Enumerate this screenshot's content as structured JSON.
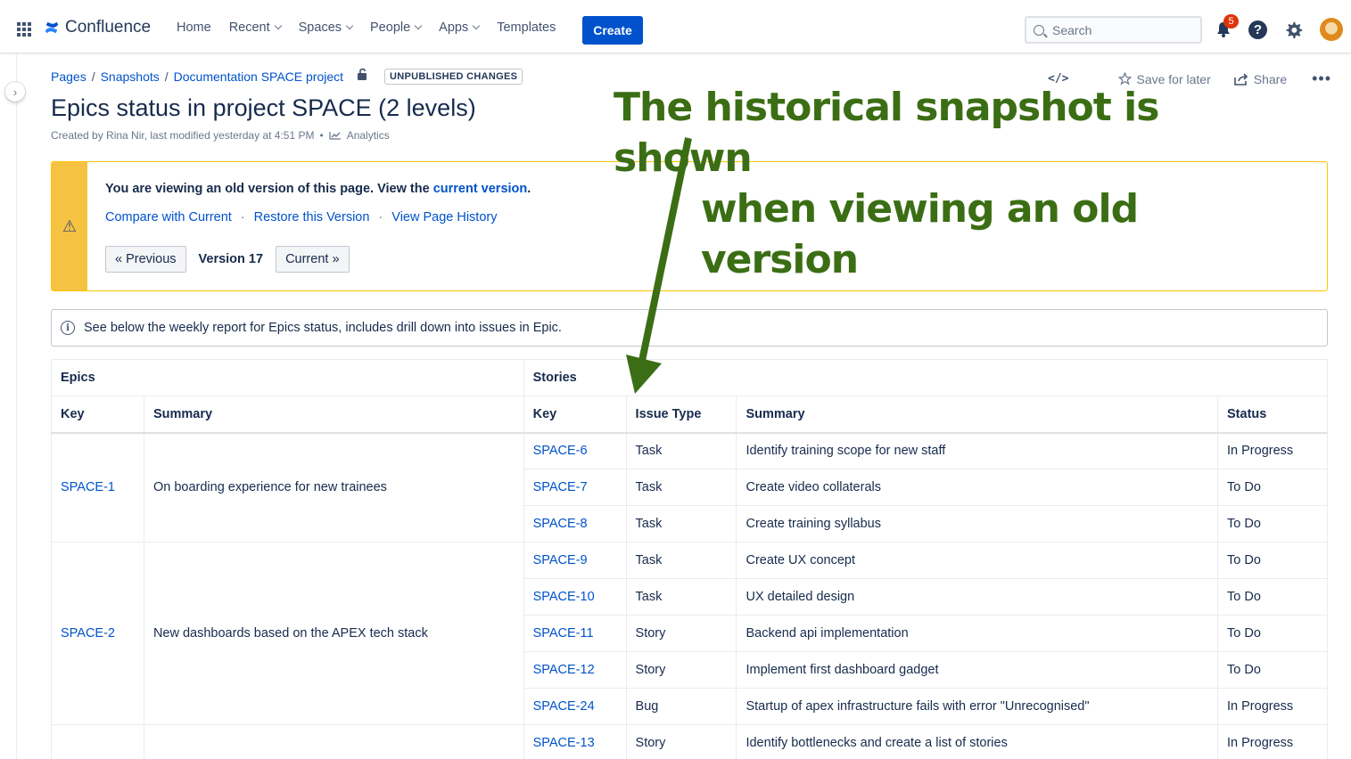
{
  "topnav": {
    "product": "Confluence",
    "items": [
      {
        "label": "Home",
        "dropdown": false
      },
      {
        "label": "Recent",
        "dropdown": true
      },
      {
        "label": "Spaces",
        "dropdown": true
      },
      {
        "label": "People",
        "dropdown": true
      },
      {
        "label": "Apps",
        "dropdown": true
      },
      {
        "label": "Templates",
        "dropdown": false
      }
    ],
    "create_label": "Create",
    "search_placeholder": "Search",
    "notification_count": "5",
    "help_glyph": "?"
  },
  "breadcrumb": {
    "items": [
      "Pages",
      "Snapshots",
      "Documentation SPACE project"
    ],
    "status_lozenge": "UNPUBLISHED CHANGES"
  },
  "page_actions": {
    "source_glyph": "</>",
    "save_label": "Save for later",
    "share_label": "Share",
    "more_glyph": "•••"
  },
  "page": {
    "title": "Epics status in project SPACE (2 levels)",
    "byline": "Created by Rina Nir, last modified yesterday at 4:51 PM",
    "byline_sep": "•",
    "analytics_label": "Analytics"
  },
  "annotation": {
    "line1": "The historical snapshot is shown",
    "line2": "when viewing an old version",
    "color": "#3b6e14"
  },
  "old_version": {
    "message_prefix": "You are viewing an old version of this page. View the ",
    "message_link": "current version",
    "message_suffix": ".",
    "links": [
      "Compare with Current",
      "Restore this Version",
      "View Page History"
    ],
    "link_sep": "·",
    "prev_label": "« Previous",
    "version_label": "Version 17",
    "current_label": "Current »",
    "warning_glyph": "⚠"
  },
  "info": {
    "text": "See below the weekly report for Epics status, includes drill down into issues in Epic.",
    "icon_glyph": "i"
  },
  "table": {
    "group_headers": [
      "Epics",
      "Stories"
    ],
    "columns": [
      "Key",
      "Summary",
      "Key",
      "Issue Type",
      "Summary",
      "Status"
    ],
    "epics": [
      {
        "key": "SPACE-1",
        "summary": "On boarding experience for new trainees",
        "stories": [
          {
            "key": "SPACE-6",
            "type": "Task",
            "summary": "Identify training scope for new staff",
            "status": "In Progress"
          },
          {
            "key": "SPACE-7",
            "type": "Task",
            "summary": "Create video collaterals",
            "status": "To Do"
          },
          {
            "key": "SPACE-8",
            "type": "Task",
            "summary": "Create training syllabus",
            "status": "To Do"
          }
        ]
      },
      {
        "key": "SPACE-2",
        "summary": "New dashboards based on the APEX tech stack",
        "stories": [
          {
            "key": "SPACE-9",
            "type": "Task",
            "summary": "Create UX concept",
            "status": "To Do"
          },
          {
            "key": "SPACE-10",
            "type": "Task",
            "summary": "UX detailed design",
            "status": "To Do"
          },
          {
            "key": "SPACE-11",
            "type": "Story",
            "summary": "Backend api implementation",
            "status": "To Do"
          },
          {
            "key": "SPACE-12",
            "type": "Story",
            "summary": "Implement first dashboard gadget",
            "status": "To Do"
          },
          {
            "key": "SPACE-24",
            "type": "Bug",
            "summary": "Startup of apex infrastructure fails with error \"Unrecognised\"",
            "status": "In Progress"
          }
        ]
      },
      {
        "key": "",
        "summary": "",
        "stories": [
          {
            "key": "SPACE-13",
            "type": "Story",
            "summary": "Identify bottlenecks and create a list of stories",
            "status": "In Progress"
          }
        ]
      }
    ]
  }
}
